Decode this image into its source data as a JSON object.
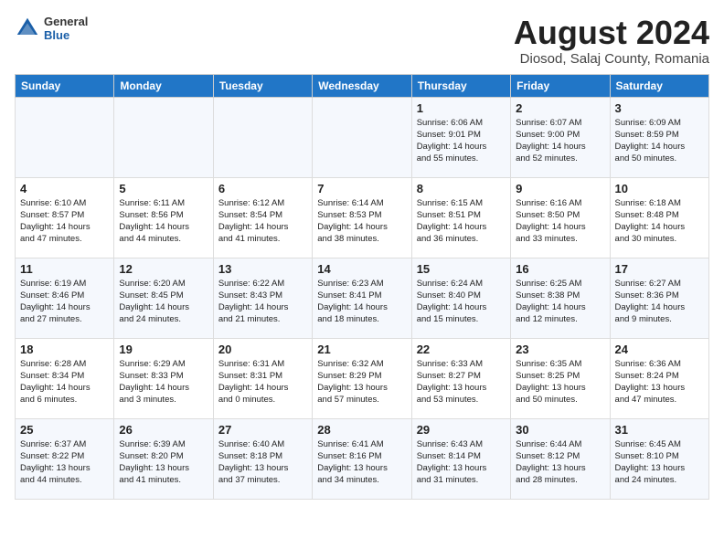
{
  "header": {
    "logo_general": "General",
    "logo_blue": "Blue",
    "month_title": "August 2024",
    "subtitle": "Diosod, Salaj County, Romania"
  },
  "days_of_week": [
    "Sunday",
    "Monday",
    "Tuesday",
    "Wednesday",
    "Thursday",
    "Friday",
    "Saturday"
  ],
  "weeks": [
    [
      {
        "day": "",
        "info": ""
      },
      {
        "day": "",
        "info": ""
      },
      {
        "day": "",
        "info": ""
      },
      {
        "day": "",
        "info": ""
      },
      {
        "day": "1",
        "info": "Sunrise: 6:06 AM\nSunset: 9:01 PM\nDaylight: 14 hours\nand 55 minutes."
      },
      {
        "day": "2",
        "info": "Sunrise: 6:07 AM\nSunset: 9:00 PM\nDaylight: 14 hours\nand 52 minutes."
      },
      {
        "day": "3",
        "info": "Sunrise: 6:09 AM\nSunset: 8:59 PM\nDaylight: 14 hours\nand 50 minutes."
      }
    ],
    [
      {
        "day": "4",
        "info": "Sunrise: 6:10 AM\nSunset: 8:57 PM\nDaylight: 14 hours\nand 47 minutes."
      },
      {
        "day": "5",
        "info": "Sunrise: 6:11 AM\nSunset: 8:56 PM\nDaylight: 14 hours\nand 44 minutes."
      },
      {
        "day": "6",
        "info": "Sunrise: 6:12 AM\nSunset: 8:54 PM\nDaylight: 14 hours\nand 41 minutes."
      },
      {
        "day": "7",
        "info": "Sunrise: 6:14 AM\nSunset: 8:53 PM\nDaylight: 14 hours\nand 38 minutes."
      },
      {
        "day": "8",
        "info": "Sunrise: 6:15 AM\nSunset: 8:51 PM\nDaylight: 14 hours\nand 36 minutes."
      },
      {
        "day": "9",
        "info": "Sunrise: 6:16 AM\nSunset: 8:50 PM\nDaylight: 14 hours\nand 33 minutes."
      },
      {
        "day": "10",
        "info": "Sunrise: 6:18 AM\nSunset: 8:48 PM\nDaylight: 14 hours\nand 30 minutes."
      }
    ],
    [
      {
        "day": "11",
        "info": "Sunrise: 6:19 AM\nSunset: 8:46 PM\nDaylight: 14 hours\nand 27 minutes."
      },
      {
        "day": "12",
        "info": "Sunrise: 6:20 AM\nSunset: 8:45 PM\nDaylight: 14 hours\nand 24 minutes."
      },
      {
        "day": "13",
        "info": "Sunrise: 6:22 AM\nSunset: 8:43 PM\nDaylight: 14 hours\nand 21 minutes."
      },
      {
        "day": "14",
        "info": "Sunrise: 6:23 AM\nSunset: 8:41 PM\nDaylight: 14 hours\nand 18 minutes."
      },
      {
        "day": "15",
        "info": "Sunrise: 6:24 AM\nSunset: 8:40 PM\nDaylight: 14 hours\nand 15 minutes."
      },
      {
        "day": "16",
        "info": "Sunrise: 6:25 AM\nSunset: 8:38 PM\nDaylight: 14 hours\nand 12 minutes."
      },
      {
        "day": "17",
        "info": "Sunrise: 6:27 AM\nSunset: 8:36 PM\nDaylight: 14 hours\nand 9 minutes."
      }
    ],
    [
      {
        "day": "18",
        "info": "Sunrise: 6:28 AM\nSunset: 8:34 PM\nDaylight: 14 hours\nand 6 minutes."
      },
      {
        "day": "19",
        "info": "Sunrise: 6:29 AM\nSunset: 8:33 PM\nDaylight: 14 hours\nand 3 minutes."
      },
      {
        "day": "20",
        "info": "Sunrise: 6:31 AM\nSunset: 8:31 PM\nDaylight: 14 hours\nand 0 minutes."
      },
      {
        "day": "21",
        "info": "Sunrise: 6:32 AM\nSunset: 8:29 PM\nDaylight: 13 hours\nand 57 minutes."
      },
      {
        "day": "22",
        "info": "Sunrise: 6:33 AM\nSunset: 8:27 PM\nDaylight: 13 hours\nand 53 minutes."
      },
      {
        "day": "23",
        "info": "Sunrise: 6:35 AM\nSunset: 8:25 PM\nDaylight: 13 hours\nand 50 minutes."
      },
      {
        "day": "24",
        "info": "Sunrise: 6:36 AM\nSunset: 8:24 PM\nDaylight: 13 hours\nand 47 minutes."
      }
    ],
    [
      {
        "day": "25",
        "info": "Sunrise: 6:37 AM\nSunset: 8:22 PM\nDaylight: 13 hours\nand 44 minutes."
      },
      {
        "day": "26",
        "info": "Sunrise: 6:39 AM\nSunset: 8:20 PM\nDaylight: 13 hours\nand 41 minutes."
      },
      {
        "day": "27",
        "info": "Sunrise: 6:40 AM\nSunset: 8:18 PM\nDaylight: 13 hours\nand 37 minutes."
      },
      {
        "day": "28",
        "info": "Sunrise: 6:41 AM\nSunset: 8:16 PM\nDaylight: 13 hours\nand 34 minutes."
      },
      {
        "day": "29",
        "info": "Sunrise: 6:43 AM\nSunset: 8:14 PM\nDaylight: 13 hours\nand 31 minutes."
      },
      {
        "day": "30",
        "info": "Sunrise: 6:44 AM\nSunset: 8:12 PM\nDaylight: 13 hours\nand 28 minutes."
      },
      {
        "day": "31",
        "info": "Sunrise: 6:45 AM\nSunset: 8:10 PM\nDaylight: 13 hours\nand 24 minutes."
      }
    ]
  ]
}
